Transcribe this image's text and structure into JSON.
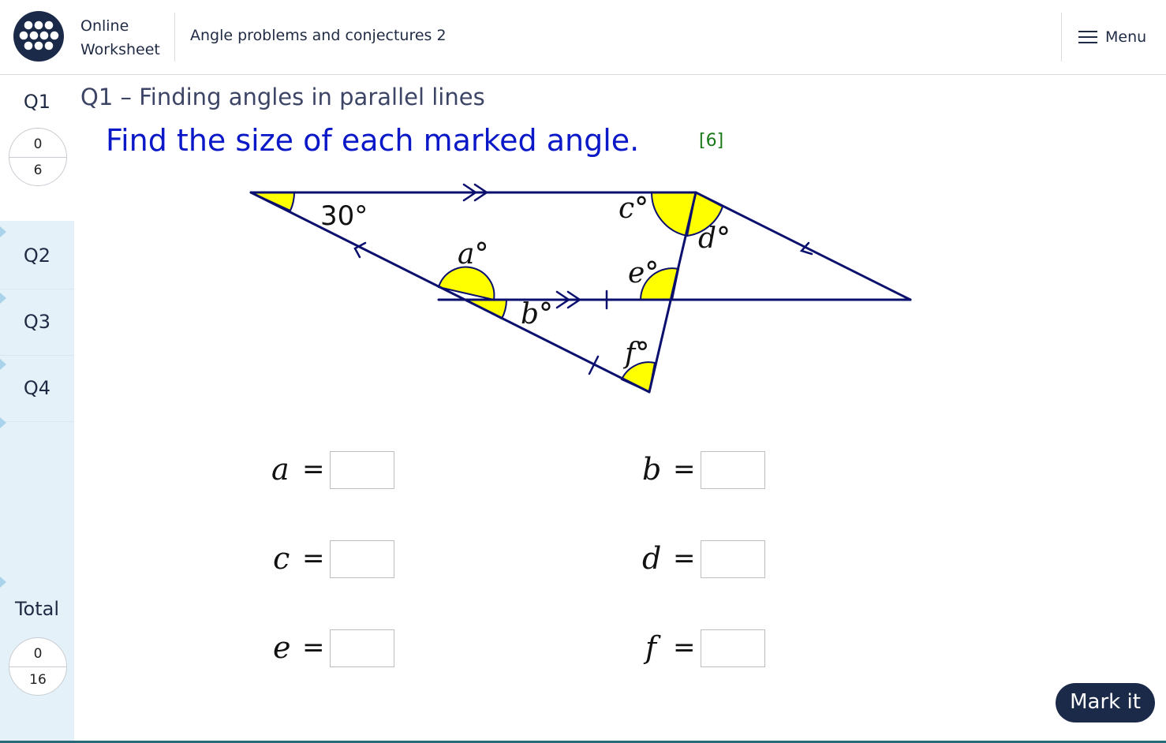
{
  "header": {
    "brand_line1": "Online",
    "brand_line2": "Worksheet",
    "title": "Angle problems and conjectures 2",
    "menu_label": "Menu"
  },
  "sidebar": {
    "current": {
      "label": "Q1",
      "score": "0",
      "max": "6"
    },
    "tabs": [
      {
        "label": "Q2"
      },
      {
        "label": "Q3"
      },
      {
        "label": "Q4"
      }
    ],
    "total": {
      "label": "Total",
      "score": "0",
      "max": "16"
    }
  },
  "question": {
    "heading": "Q1 – Finding angles in parallel lines",
    "instruction": "Find the size of each marked angle.",
    "marks": "[6]"
  },
  "diagram": {
    "given_angle": "30°",
    "labels": {
      "a": "a°",
      "b": "b°",
      "c": "c°",
      "d": "d°",
      "e": "e°",
      "f": "f°"
    },
    "colors": {
      "line": "#0b0f6e",
      "fill": "#ffff00"
    }
  },
  "answers": [
    {
      "var": "a",
      "eq": "=",
      "value": ""
    },
    {
      "var": "b",
      "eq": "=",
      "value": ""
    },
    {
      "var": "c",
      "eq": "=",
      "value": ""
    },
    {
      "var": "d",
      "eq": "=",
      "value": ""
    },
    {
      "var": "e",
      "eq": "=",
      "value": ""
    },
    {
      "var": "f",
      "eq": "=",
      "value": ""
    }
  ],
  "actions": {
    "mark_label": "Mark it"
  },
  "colors": {
    "navy": "#1c2a4a",
    "instruction": "#0a18c8",
    "marks": "#1a7a1a",
    "sidebar": "#e5f1f8"
  }
}
